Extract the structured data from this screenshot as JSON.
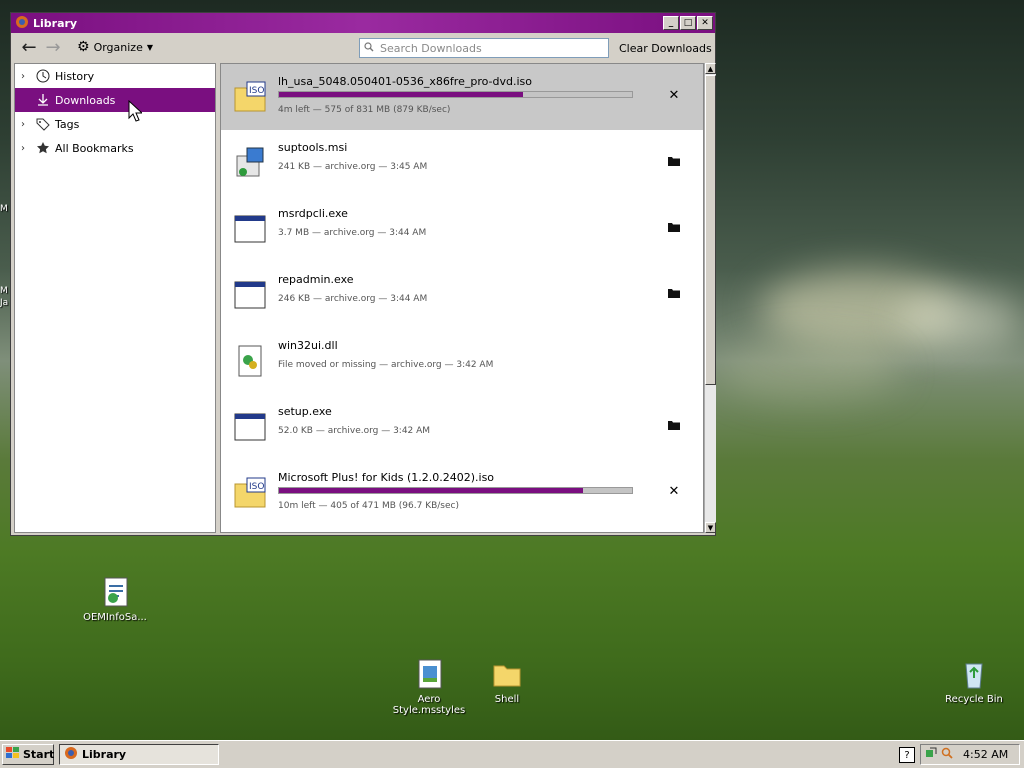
{
  "window": {
    "title": "Library",
    "buttons": {
      "minimize": "_",
      "maximize": "□",
      "close": "✕"
    }
  },
  "toolbar": {
    "organize_label": "Organize",
    "search_placeholder": "Search Downloads",
    "clear_label": "Clear Downloads"
  },
  "sidebar": {
    "items": [
      {
        "label": "History",
        "icon": "clock-icon",
        "expander": true,
        "selected": false
      },
      {
        "label": "Downloads",
        "icon": "download-icon",
        "expander": false,
        "selected": true
      },
      {
        "label": "Tags",
        "icon": "tag-icon",
        "expander": true,
        "selected": false
      },
      {
        "label": "All Bookmarks",
        "icon": "star-icon",
        "expander": true,
        "selected": false
      }
    ]
  },
  "downloads": [
    {
      "name": "lh_usa_5048.050401-0536_x86fre_pro-dvd.iso",
      "status": "4m left — 575 of 831 MB (879 KB/sec)",
      "progress": 0.69,
      "icon": "iso-icon",
      "action": "cancel-icon",
      "active": true
    },
    {
      "name": "suptools.msi",
      "status": "241 KB — archive.org — 3:45 AM",
      "icon": "msi-icon",
      "action": "folder-icon"
    },
    {
      "name": "msrdpcli.exe",
      "status": "3.7 MB — archive.org — 3:44 AM",
      "icon": "exe-icon",
      "action": "folder-icon"
    },
    {
      "name": "repadmin.exe",
      "status": "246 KB — archive.org — 3:44 AM",
      "icon": "exe-icon",
      "action": "folder-icon"
    },
    {
      "name": "win32ui.dll",
      "status": "File moved or missing — archive.org — 3:42 AM",
      "icon": "dll-icon",
      "action": ""
    },
    {
      "name": "setup.exe",
      "status": "52.0 KB — archive.org — 3:42 AM",
      "icon": "exe-icon",
      "action": "folder-icon"
    },
    {
      "name": "Microsoft Plus! for Kids (1.2.0.2402).iso",
      "status": "10m left — 405 of 471 MB (96.7 KB/sec)",
      "progress": 0.86,
      "icon": "iso-icon",
      "action": "cancel-icon"
    }
  ],
  "desktop": {
    "icons": [
      {
        "label": "OEMInfoSa...",
        "icon": "oeminfo-icon"
      },
      {
        "label": "Aero Style.msstyles",
        "icon": "msstyles-icon"
      },
      {
        "label": "Shell",
        "icon": "folder-icon"
      },
      {
        "label": "Recycle Bin",
        "icon": "recycle-bin-icon"
      }
    ],
    "edge_texts": [
      "M",
      "M",
      "Ja"
    ]
  },
  "taskbar": {
    "start_label": "Start",
    "task_label": "Library",
    "help_label": "?",
    "clock": "4:52 AM"
  },
  "colors": {
    "accent": "#7a0f80"
  }
}
